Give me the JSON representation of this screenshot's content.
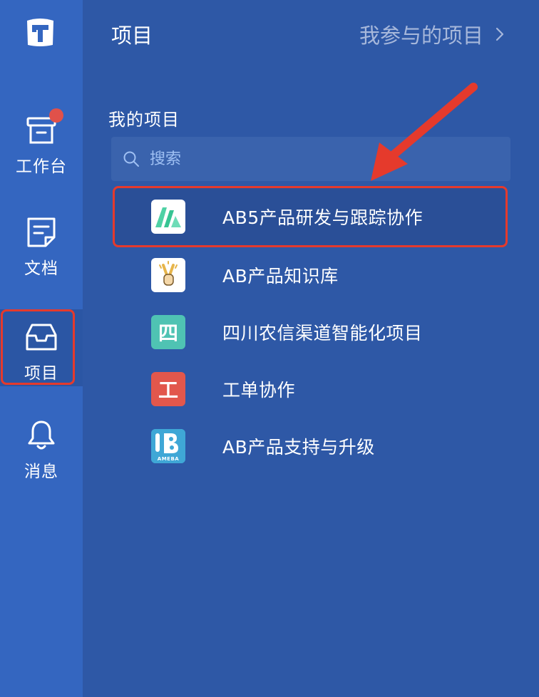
{
  "rail": {
    "nav": [
      {
        "label": "工作台",
        "icon": "inbox-archive-icon",
        "has_badge": true
      },
      {
        "label": "文档",
        "icon": "document-icon"
      },
      {
        "label": "项目",
        "icon": "project-tray-icon",
        "active": true
      },
      {
        "label": "消息",
        "icon": "bell-icon"
      }
    ]
  },
  "header": {
    "title": "项目",
    "link_label": "我参与的项目"
  },
  "my_projects": {
    "section_title": "我的项目",
    "search_placeholder": "搜索",
    "items": [
      {
        "name": "AB5产品研发与跟踪协作",
        "icon": "m-logo-icon",
        "selected": true
      },
      {
        "name": "AB产品知识库",
        "icon": "victory-hand-icon"
      },
      {
        "name": "四川农信渠道智能化项目",
        "icon_text": "四",
        "icon_color": "#4fc3b3"
      },
      {
        "name": "工单协作",
        "icon_text": "工",
        "icon_color": "#e2574c"
      },
      {
        "name": "AB产品支持与升级",
        "icon": "ameba-logo-icon",
        "icon_text": "AMEBA"
      }
    ]
  },
  "colors": {
    "background": "#2e58a6",
    "rail": "#3466c0",
    "highlight": "#e53a2c",
    "muted_text": "#a7b8db"
  }
}
